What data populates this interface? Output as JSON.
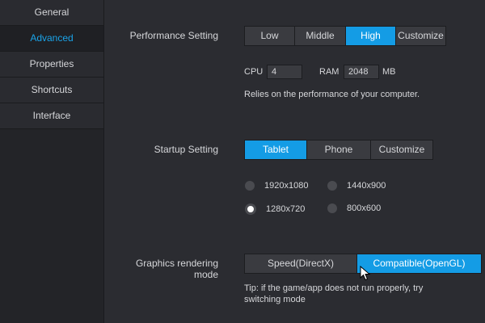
{
  "sidebar": {
    "items": [
      {
        "label": "General"
      },
      {
        "label": "Advanced"
      },
      {
        "label": "Properties"
      },
      {
        "label": "Shortcuts"
      },
      {
        "label": "Interface"
      }
    ],
    "active": "Advanced"
  },
  "performance": {
    "label": "Performance Setting",
    "options": [
      "Low",
      "Middle",
      "High",
      "Customize"
    ],
    "selected": "High",
    "cpu_label": "CPU",
    "cpu_value": "4",
    "ram_label": "RAM",
    "ram_value": "2048",
    "ram_unit": "MB",
    "note": "Relies on the performance of your computer."
  },
  "startup": {
    "label": "Startup Setting",
    "options": [
      "Tablet",
      "Phone",
      "Customize"
    ],
    "selected": "Tablet",
    "resolutions": [
      "1920x1080",
      "1440x900",
      "1280x720",
      "800x600"
    ],
    "selected_resolution": "1280x720"
  },
  "graphics": {
    "label": "Graphics rendering mode",
    "options": [
      "Speed(DirectX)",
      "Compatible(OpenGL)"
    ],
    "selected": "Compatible(OpenGL)",
    "tip_line1": "Tip: if the game/app does not run properly, try",
    "tip_line2": "switching mode"
  },
  "colors": {
    "accent": "#149ce5",
    "active_nav_text": "#1aa3e8",
    "background": "#2b2c31"
  }
}
